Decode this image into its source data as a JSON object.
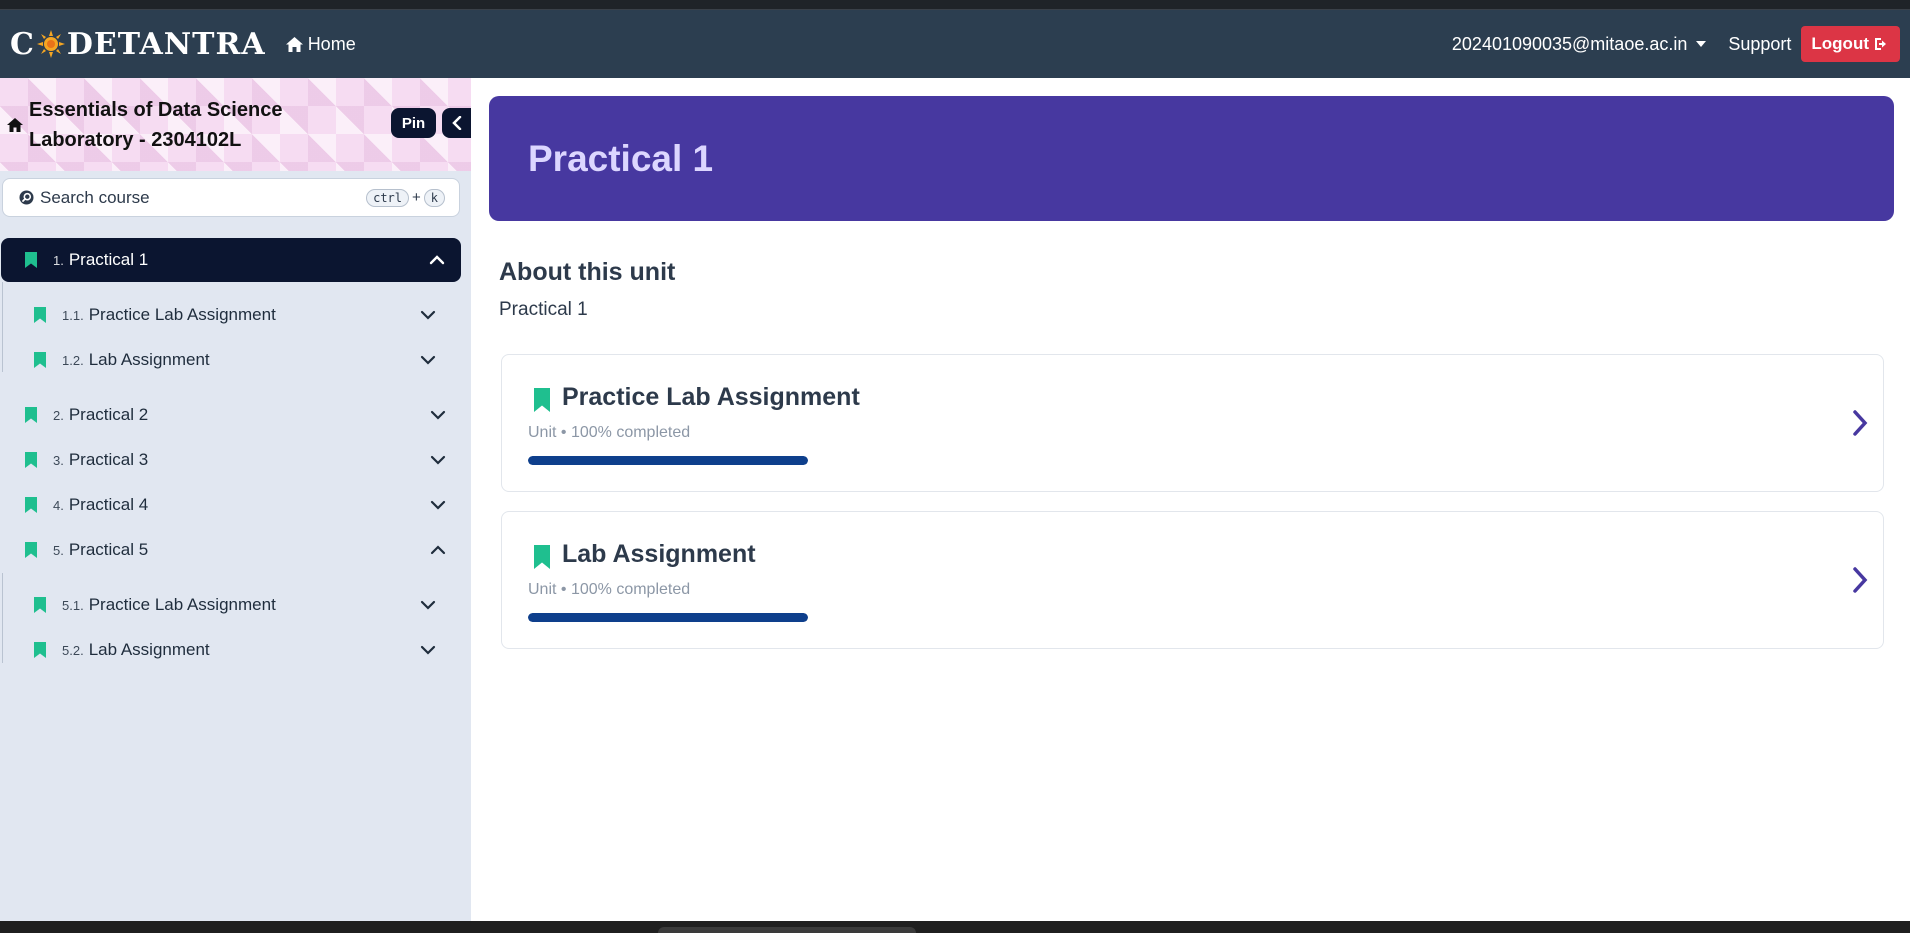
{
  "navbar": {
    "brand_left": "C",
    "brand_right": "DETANTRA",
    "brand_full": "CODETANTRA",
    "home_label": "Home",
    "user_email": "202401090035@mitaoe.ac.in",
    "support_label": "Support",
    "logout_label": "Logout",
    "colors": {
      "navbar_bg": "#2c3e50",
      "logout_bg": "#dc3545"
    }
  },
  "sidebar": {
    "course_title_line1": "Essentials of Data Science",
    "course_title_line2": "Laboratory - 2304102L",
    "pin_label": "Pin",
    "search_placeholder": "Search course",
    "shortcut_key1": "ctrl",
    "shortcut_plus": "+",
    "shortcut_key2": "k",
    "items": [
      {
        "num": "1.",
        "label": "Practical 1",
        "active": true,
        "expanded": true,
        "level": 0
      },
      {
        "num": "1.1.",
        "label": "Practice Lab Assignment",
        "active": false,
        "expanded": false,
        "level": 1
      },
      {
        "num": "1.2.",
        "label": "Lab Assignment",
        "active": false,
        "expanded": false,
        "level": 1
      },
      {
        "num": "2.",
        "label": "Practical 2",
        "active": false,
        "expanded": false,
        "level": 0
      },
      {
        "num": "3.",
        "label": "Practical 3",
        "active": false,
        "expanded": false,
        "level": 0
      },
      {
        "num": "4.",
        "label": "Practical 4",
        "active": false,
        "expanded": false,
        "level": 0
      },
      {
        "num": "5.",
        "label": "Practical 5",
        "active": false,
        "expanded": true,
        "level": 0
      },
      {
        "num": "5.1.",
        "label": "Practice Lab Assignment",
        "active": false,
        "expanded": false,
        "level": 1
      },
      {
        "num": "5.2.",
        "label": "Lab Assignment",
        "active": false,
        "expanded": false,
        "level": 1
      }
    ],
    "colors": {
      "sidebar_bg": "#e1e7f1",
      "active_bg": "#0b1530",
      "bookmark": "#1fbf8f"
    }
  },
  "main": {
    "banner_title": "Practical 1",
    "about_heading": "About this unit",
    "about_text": "Practical 1",
    "units": [
      {
        "title": "Practice Lab Assignment",
        "meta": "Unit • 100% completed",
        "progress": 1.0
      },
      {
        "title": "Lab Assignment",
        "meta": "Unit • 100% completed",
        "progress": 1.0
      }
    ],
    "colors": {
      "banner_bg": "#4738a0",
      "progress_fill": "#0e3f8c",
      "chevron": "#4738a0"
    }
  },
  "icons": [
    "home-icon",
    "user-caret-icon",
    "logout-icon",
    "search-icon",
    "bookmark-icon",
    "chevron-up-icon",
    "chevron-down-icon",
    "chevron-left-icon",
    "chevron-right-icon"
  ]
}
